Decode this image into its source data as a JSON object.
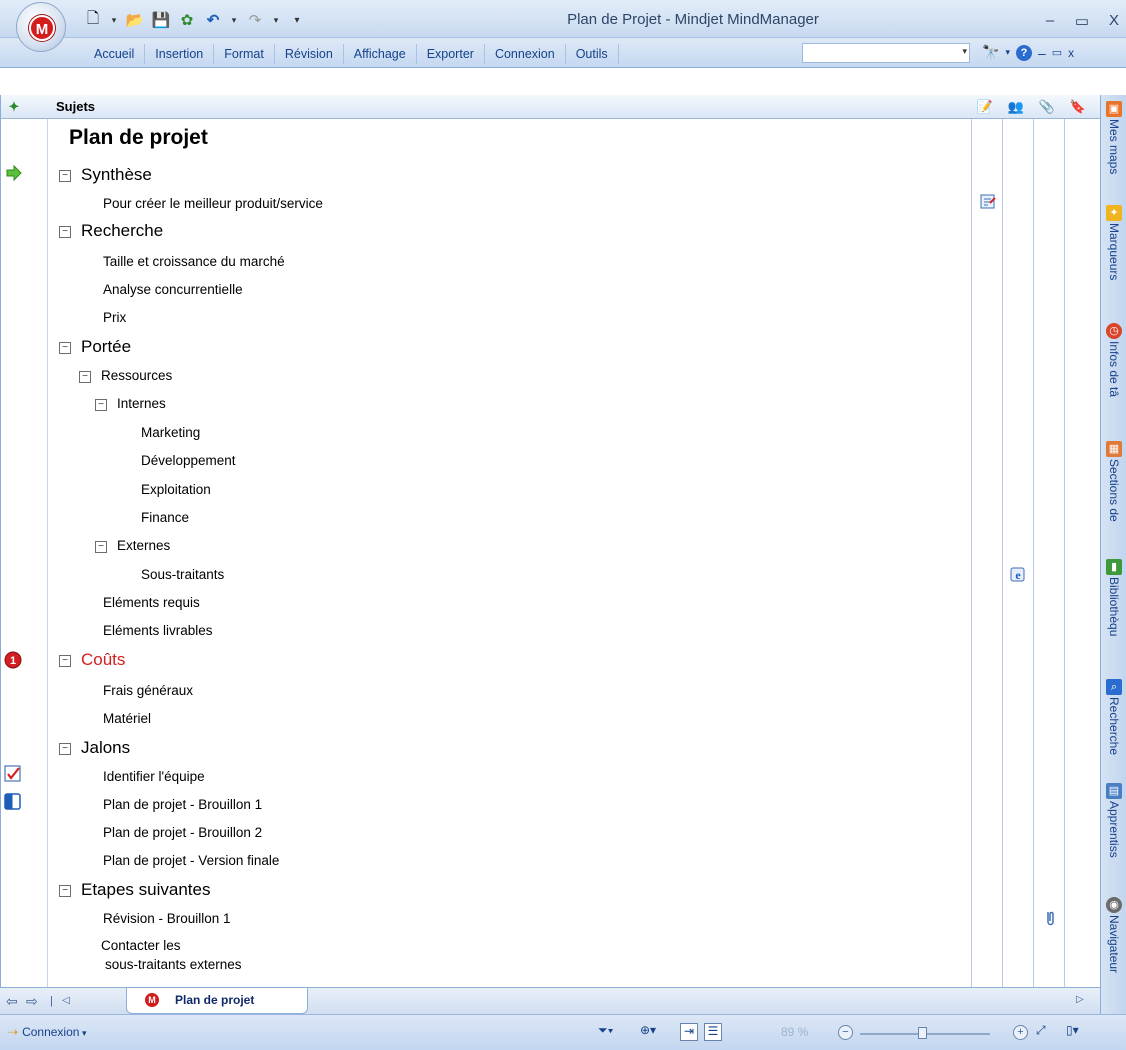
{
  "window": {
    "title": "Plan de Projet - Mindjet MindManager",
    "controls": [
      "–",
      "▭",
      "X"
    ]
  },
  "quick_access": {
    "icons": [
      "new-doc-icon",
      "open-folder-icon",
      "save-icon",
      "mindmap-icon",
      "undo-icon",
      "redo-icon",
      "customize-icon"
    ]
  },
  "app_button": {
    "label": "M"
  },
  "ribbon": {
    "tabs": [
      "Accueil",
      "Insertion",
      "Format",
      "Révision",
      "Affichage",
      "Exporter",
      "Connexion",
      "Outils"
    ],
    "search_value": "",
    "tools": [
      "binoculars-icon",
      "help-icon",
      "minimize-icon",
      "restore-icon",
      "close-icon"
    ]
  },
  "outline": {
    "header_title": "Sujets",
    "column_icons": [
      "notes-icon",
      "task-resources-icon",
      "attachment-icon",
      "bookmark-icon"
    ],
    "central_topic": "Plan de projet",
    "topics": {
      "synthese": "Synthèse",
      "pour_creer": "Pour créer le meilleur produit/service",
      "recherche": "Recherche",
      "taille": "Taille et croissance du marché",
      "analyse": "Analyse concurrentielle",
      "prix": "Prix",
      "portee": "Portée",
      "ressources": "Ressources",
      "internes": "Internes",
      "marketing": "Marketing",
      "developpement": "Développement",
      "exploitation": "Exploitation",
      "finance": "Finance",
      "externes": "Externes",
      "sous_traitants": "Sous-traitants",
      "elements_requis": "Eléments requis",
      "elements_livrables": "Eléments livrables",
      "couts": "Coûts",
      "frais": "Frais généraux",
      "materiel": "Matériel",
      "jalons": "Jalons",
      "identifier": "Identifier l'équipe",
      "brouillon1": "Plan de projet - Brouillon 1",
      "brouillon2": "Plan de projet - Brouillon 2",
      "version_finale": "Plan de projet - Version finale",
      "etapes": "Etapes suivantes",
      "revision": "Révision - Brouillon 1",
      "contacter_1": "Contacter les",
      "contacter_2": "sous-traitants externes"
    },
    "expand_glyph": "−",
    "markers": {
      "priority_number": "1"
    }
  },
  "side_panel": {
    "tabs": [
      "Mes maps",
      "Marqueurs",
      "Infos de tâ",
      "Sections de",
      "Bibliothèqu",
      "Recherche",
      "Apprentiss",
      "Navigateur"
    ]
  },
  "doc_tabs": {
    "active": "Plan de projet"
  },
  "status_bar": {
    "connection": "Connexion",
    "zoom": "89 %"
  },
  "colors": {
    "accent": "#15428b",
    "cost_topic": "#d21f1f",
    "brand": "#d31c1c"
  }
}
